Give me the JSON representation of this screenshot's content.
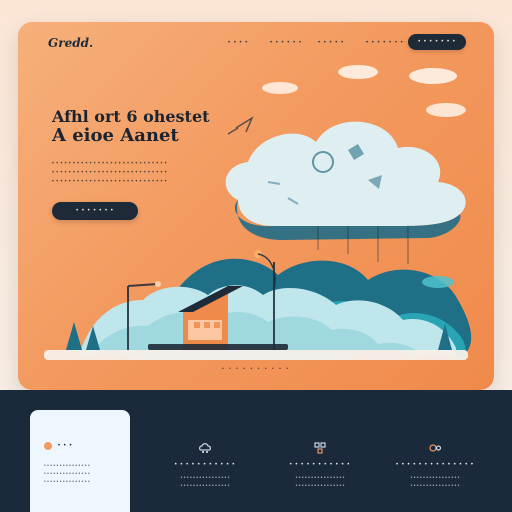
{
  "brand": {
    "logo": "Gredd."
  },
  "nav": {
    "links": [
      "• • • •",
      "• • • • • •",
      "• • • • •",
      "• • • • • • •"
    ],
    "cta": "• • • • • • •"
  },
  "hero": {
    "headline_line1": "Afhl ort 6 ohestet",
    "headline_line2": "A eioe Aanet",
    "subtext_rows": [
      "• • • • • • • • • • • • • • • • • • • • • • • • • • • •",
      "• • • • • • • • • • • • • • • • • • • • • • • • • • • •",
      "• • • • • • • • • • • • • • • • • • • • • • • • • • • •"
    ],
    "cta": "• • • • • • •"
  },
  "section": {
    "caption": "• • • •   • • •   • • •"
  },
  "features": {
    "panel": {
      "label": "• • •",
      "rows": [
        "• • • • • • • • • • • • • • •",
        "• • • • • • • • • • • • • • •",
        "• • • • • • • • • • • • • • •"
      ]
    },
    "items": [
      {
        "icon": "cloud-network-icon",
        "title": "• • • • • • • • • • •",
        "rows": [
          "• • • • • • • • • • • • • • • •",
          "• • • • • • • • • • • • • • • •"
        ]
      },
      {
        "icon": "grid-nodes-icon",
        "title": "• • • • • • • • • • •",
        "rows": [
          "• • • • • • • • • • • • • • • •",
          "• • • • • • • • • • • • • • • •"
        ]
      },
      {
        "icon": "settings-flow-icon",
        "title": "• • • • • • • • • • • • • •",
        "rows": [
          "• • • • • • • • • • • • • • • •",
          "• • • • • • • • • • • • • • • •"
        ]
      }
    ]
  },
  "colors": {
    "hero_orange": "#f39a60",
    "navy": "#1e2a37",
    "teal": "#2aa7b6",
    "light_blue": "#eef6ff"
  }
}
